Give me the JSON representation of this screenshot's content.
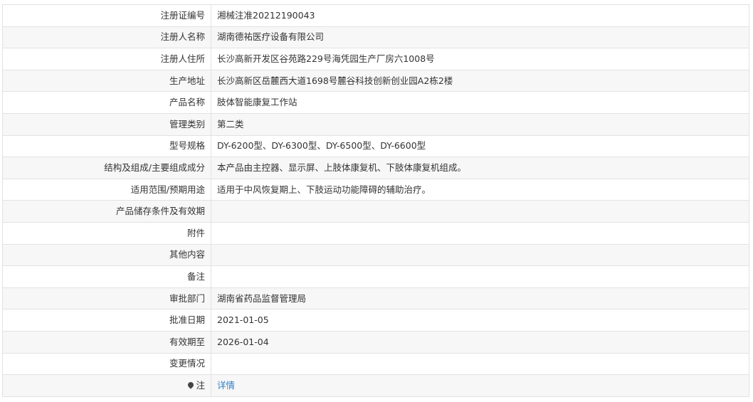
{
  "rows": [
    {
      "label": "注册证编号",
      "value": "湘械注准20212190043"
    },
    {
      "label": "注册人名称",
      "value": "湖南德祐医疗设备有限公司"
    },
    {
      "label": "注册人住所",
      "value": "长沙高新开发区谷苑路229号海凭园生产厂房六1008号"
    },
    {
      "label": "生产地址",
      "value": "长沙高新区岳麓西大道1698号麓谷科技创新创业园A2栋2楼"
    },
    {
      "label": "产品名称",
      "value": "肢体智能康复工作站"
    },
    {
      "label": "管理类别",
      "value": "第二类"
    },
    {
      "label": "型号规格",
      "value": "DY-6200型、DY-6300型、DY-6500型、DY-6600型"
    },
    {
      "label": "结构及组成/主要组成成分",
      "value": "本产品由主控器、显示屏、上肢体康复机、下肢体康复机组成。"
    },
    {
      "label": "适用范围/预期用途",
      "value": "适用于中风恢复期上、下肢运动功能障碍的辅助治疗。"
    },
    {
      "label": "产品储存条件及有效期",
      "value": ""
    },
    {
      "label": "附件",
      "value": ""
    },
    {
      "label": "其他内容",
      "value": ""
    },
    {
      "label": "备注",
      "value": ""
    },
    {
      "label": "审批部门",
      "value": "湖南省药品监督管理局"
    },
    {
      "label": "批准日期",
      "value": "2021-01-05"
    },
    {
      "label": "有效期至",
      "value": "2026-01-04"
    },
    {
      "label": "变更情况",
      "value": ""
    }
  ],
  "note": {
    "label": "注",
    "icon": "pin-icon",
    "link_text": "详情"
  }
}
